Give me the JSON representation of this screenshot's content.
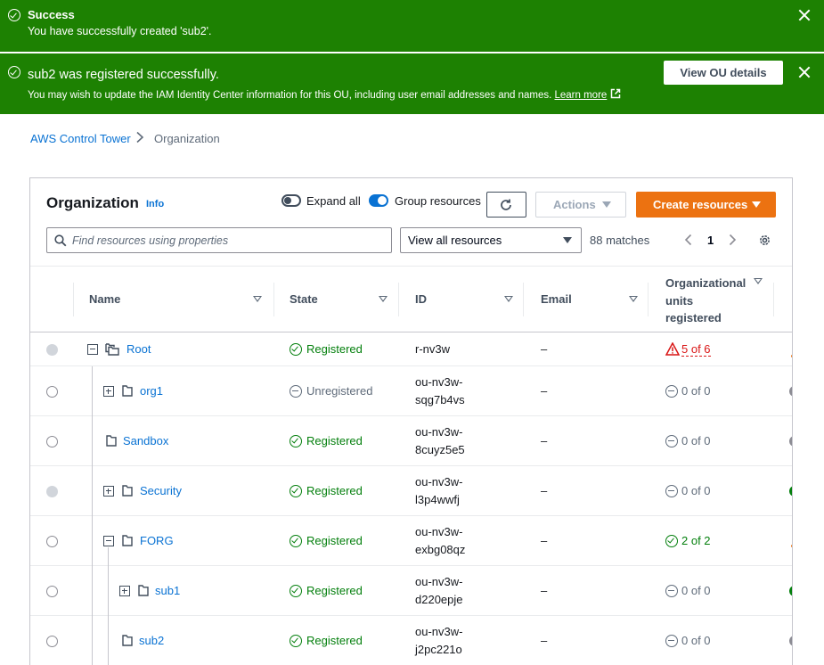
{
  "flash_success": {
    "title": "Success",
    "message": "You have successfully created 'sub2'."
  },
  "flash_registered": {
    "title": "sub2 was registered successfully.",
    "message": "You may wish to update the IAM Identity Center information for this OU, including user email addresses and names.",
    "link": "Learn more",
    "button": "View OU details"
  },
  "breadcrumb": {
    "parent": "AWS Control Tower",
    "current": "Organization"
  },
  "panel": {
    "title": "Organization",
    "info": "Info",
    "expand_all": "Expand all",
    "group_resources": "Group resources",
    "expand_all_on": false,
    "group_resources_on": true,
    "actions": "Actions",
    "create": "Create resources"
  },
  "filter": {
    "placeholder": "Find resources using properties",
    "view": "View all resources",
    "matches": "88 matches",
    "page": "1"
  },
  "columns": {
    "name": "Name",
    "state": "State",
    "id": "ID",
    "email": "Email",
    "ou_line1": "Organizational",
    "ou_line2": "units",
    "ou_line3": "registered"
  },
  "rows": [
    {
      "name": "Root",
      "state": "Registered",
      "id1": "r-nv3w",
      "id2": "",
      "email": "–",
      "ou": "5 of 6"
    },
    {
      "name": "org1",
      "state": "Unregistered",
      "id1": "ou-nv3w-",
      "id2": "sqg7b4vs",
      "email": "–",
      "ou": "0 of 0"
    },
    {
      "name": "Sandbox",
      "state": "Registered",
      "id1": "ou-nv3w-",
      "id2": "8cuyz5e5",
      "email": "–",
      "ou": "0 of 0"
    },
    {
      "name": "Security",
      "state": "Registered",
      "id1": "ou-nv3w-",
      "id2": "l3p4wwfj",
      "email": "–",
      "ou": "0 of 0"
    },
    {
      "name": "FORG",
      "state": "Registered",
      "id1": "ou-nv3w-",
      "id2": "exbg08qz",
      "email": "–",
      "ou": "2 of 2"
    },
    {
      "name": "sub1",
      "state": "Registered",
      "id1": "ou-nv3w-",
      "id2": "d220epje",
      "email": "–",
      "ou": "0 of 0"
    },
    {
      "name": "sub2",
      "state": "Registered",
      "id1": "ou-nv3w-",
      "id2": "j2pc221o",
      "email": "–",
      "ou": "0 of 0"
    }
  ],
  "colors": {
    "success_green": "#1d8102",
    "link_blue": "#0972d3",
    "primary_orange": "#ec7211",
    "status_green": "#037f0c",
    "warning_red": "#d91515"
  }
}
